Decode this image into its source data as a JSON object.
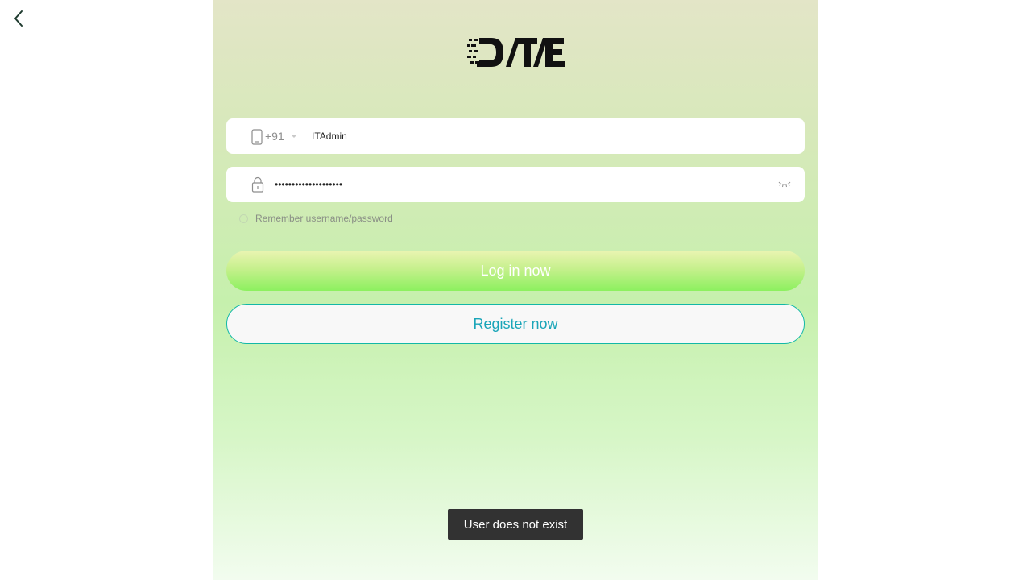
{
  "nav": {
    "back_icon": "chevron-left-icon"
  },
  "logo": {
    "text": "DTE",
    "icon": "dte-logo"
  },
  "phone_field": {
    "icon": "mobile-phone-icon",
    "country_code": "+91",
    "value": "ITAdmin"
  },
  "password_field": {
    "icon": "lock-icon",
    "value": "••••••••••••••••••••",
    "toggle_icon": "eye-closed-icon"
  },
  "remember": {
    "label": "Remember username/password",
    "checked": false
  },
  "buttons": {
    "login_label": "Log in now",
    "register_label": "Register now"
  },
  "toast": {
    "message": "User does not exist"
  },
  "colors": {
    "accent_teal": "#13b8a7",
    "register_text": "#1aa5b8",
    "login_gradient_end": "#8cf05f",
    "toast_bg": "#323232"
  }
}
